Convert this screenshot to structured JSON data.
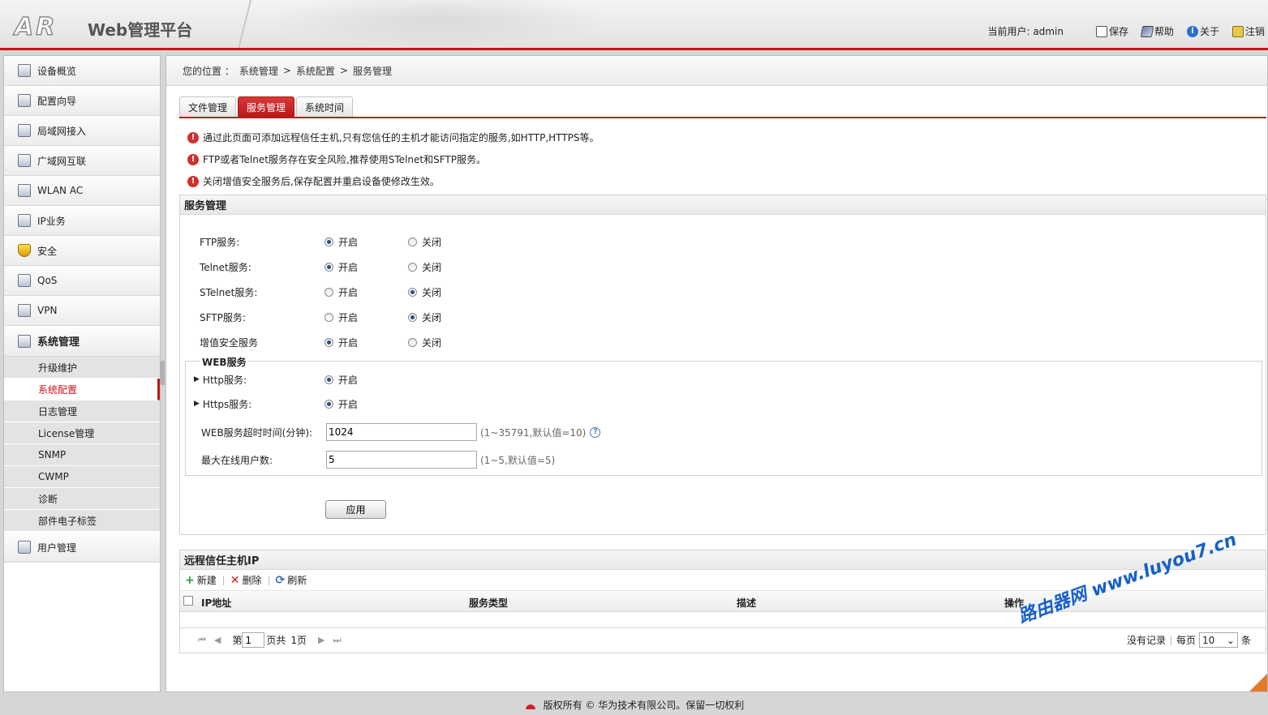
{
  "header": {
    "logo": "AR",
    "title": "Web管理平台",
    "user_label": "当前用户: admin",
    "save": "保存",
    "help": "帮助",
    "about": "关于",
    "logout": "注销"
  },
  "sidebar": {
    "items": [
      {
        "label": "设备概览"
      },
      {
        "label": "配置向导"
      },
      {
        "label": "局域网接入"
      },
      {
        "label": "广域网互联"
      },
      {
        "label": "WLAN AC"
      },
      {
        "label": "IP业务"
      },
      {
        "label": "安全"
      },
      {
        "label": "QoS"
      },
      {
        "label": "VPN"
      },
      {
        "label": "系统管理"
      },
      {
        "label": "用户管理"
      }
    ],
    "sub_items": [
      {
        "label": "升级维护"
      },
      {
        "label": "系统配置"
      },
      {
        "label": "日志管理"
      },
      {
        "label": "License管理"
      },
      {
        "label": "SNMP"
      },
      {
        "label": "CWMP"
      },
      {
        "label": "诊断"
      },
      {
        "label": "部件电子标签"
      }
    ]
  },
  "breadcrumb": [
    "您的位置 ：",
    "系统管理",
    ">",
    "系统配置",
    ">",
    "服务管理"
  ],
  "tabs": [
    "文件管理",
    "服务管理",
    "系统时间"
  ],
  "notes": [
    "通过此页面可添加远程信任主机,只有您信任的主机才能访问指定的服务,如HTTP,HTTPS等。",
    "FTP或者Telnet服务存在安全风险,推荐使用STelnet和SFTP服务。",
    "关闭增值安全服务后,保存配置并重启设备使修改生效。"
  ],
  "service_section": {
    "title": "服务管理",
    "on_label": "开启",
    "off_label": "关闭",
    "services": [
      {
        "label": "FTP服务:",
        "state": "on"
      },
      {
        "label": "Telnet服务:",
        "state": "on"
      },
      {
        "label": "STelnet服务:",
        "state": "off"
      },
      {
        "label": "SFTP服务:",
        "state": "off"
      },
      {
        "label": "增值安全服务",
        "state": "on"
      }
    ],
    "web": {
      "legend": "WEB服务",
      "http_label": "Http服务:",
      "https_label": "Https服务:",
      "timeout_label": "WEB服务超时时间(分钟):",
      "timeout_value": "1024",
      "timeout_hint": "(1~35791,默认值=10)",
      "max_users_label": "最大在线用户数:",
      "max_users_value": "5",
      "max_users_hint": "(1~5,默认值=5)"
    },
    "apply": "应用"
  },
  "ip_section": {
    "title": "远程信任主机IP",
    "new": "新建",
    "delete": "删除",
    "refresh": "刷新",
    "columns": [
      "IP地址",
      "服务类型",
      "描述",
      "操作"
    ],
    "pager": {
      "page_prefix": "第",
      "page_value": "1",
      "page_suffix": "页共",
      "total_pages": "1页",
      "no_records": "没有记录",
      "per_page_label": "每页",
      "per_page_value": "10",
      "unit": "条"
    }
  },
  "watermark": "路由器网 www.luyou7.cn",
  "footer": "版权所有 © 华为技术有限公司。保留一切权利"
}
